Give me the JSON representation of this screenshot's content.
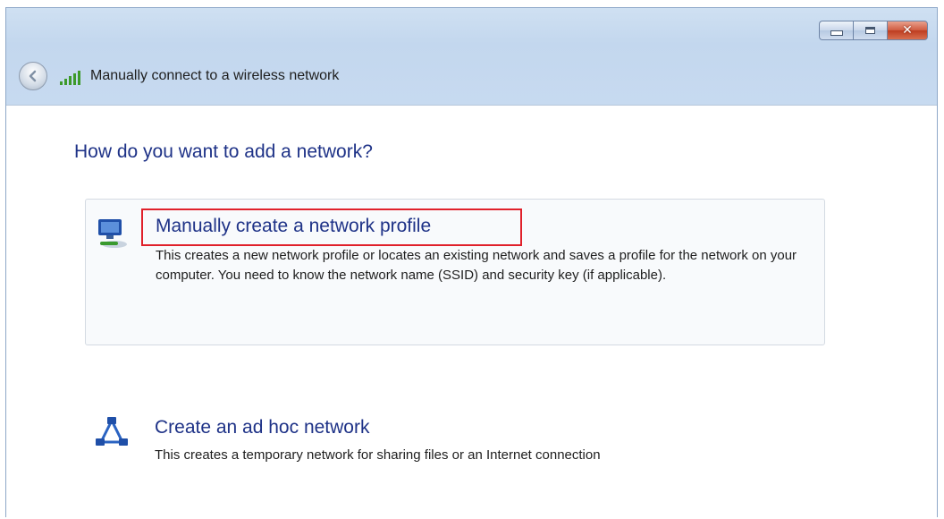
{
  "window": {
    "title": "Manually connect to a wireless network",
    "controls": {
      "minimize_icon": "minimize-icon",
      "maximize_icon": "maximize-icon",
      "close_icon": "close-icon",
      "close_glyph": "✕"
    }
  },
  "heading": "How do you want to add a network?",
  "options": [
    {
      "title": "Manually create a network profile",
      "description": "This creates a new network profile or locates an existing network and saves a profile for the network on your computer. You need to know the network name (SSID) and security key (if applicable).",
      "icon": "network-computer-icon",
      "highlighted": true
    },
    {
      "title": "Create an ad hoc network",
      "description": "This creates a temporary network for sharing files or an Internet connection",
      "icon": "ad-hoc-network-icon",
      "highlighted": false
    }
  ],
  "colors": {
    "link_blue": "#1e3287",
    "highlight_red": "#e0202a",
    "signal_green": "#3d9a2a"
  }
}
